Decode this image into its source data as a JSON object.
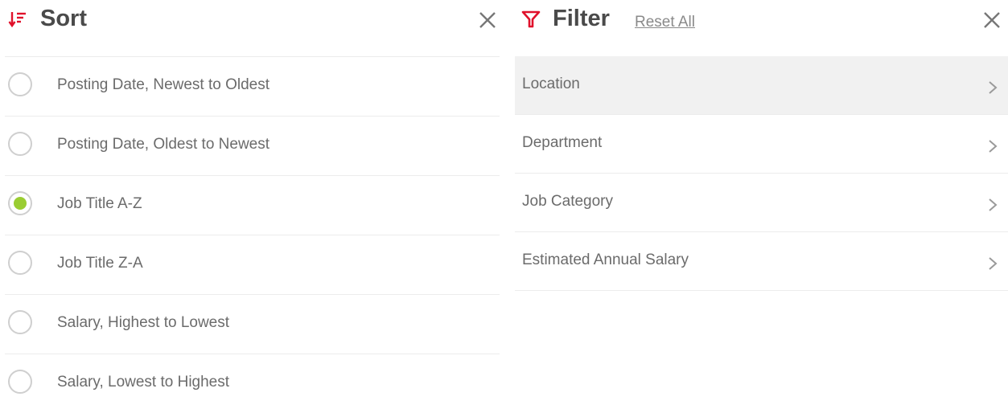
{
  "sort": {
    "title": "Sort",
    "icon": "sort-descending-icon",
    "options": [
      {
        "label": "Posting Date, Newest to Oldest",
        "selected": false
      },
      {
        "label": "Posting Date, Oldest to Newest",
        "selected": false
      },
      {
        "label": "Job Title A-Z",
        "selected": true
      },
      {
        "label": "Job Title Z-A",
        "selected": false
      },
      {
        "label": "Salary, Highest to Lowest",
        "selected": false
      },
      {
        "label": "Salary, Lowest to Highest",
        "selected": false
      }
    ]
  },
  "filter": {
    "title": "Filter",
    "icon": "funnel-icon",
    "reset_label": "Reset All",
    "items": [
      {
        "label": "Location",
        "active": true
      },
      {
        "label": "Department",
        "active": false
      },
      {
        "label": "Job Category",
        "active": false
      },
      {
        "label": "Estimated Annual Salary",
        "active": false
      }
    ]
  },
  "colors": {
    "accent": "#e0112b",
    "selected_radio": "#9acd32",
    "active_row_bg": "#f1f1f1"
  }
}
